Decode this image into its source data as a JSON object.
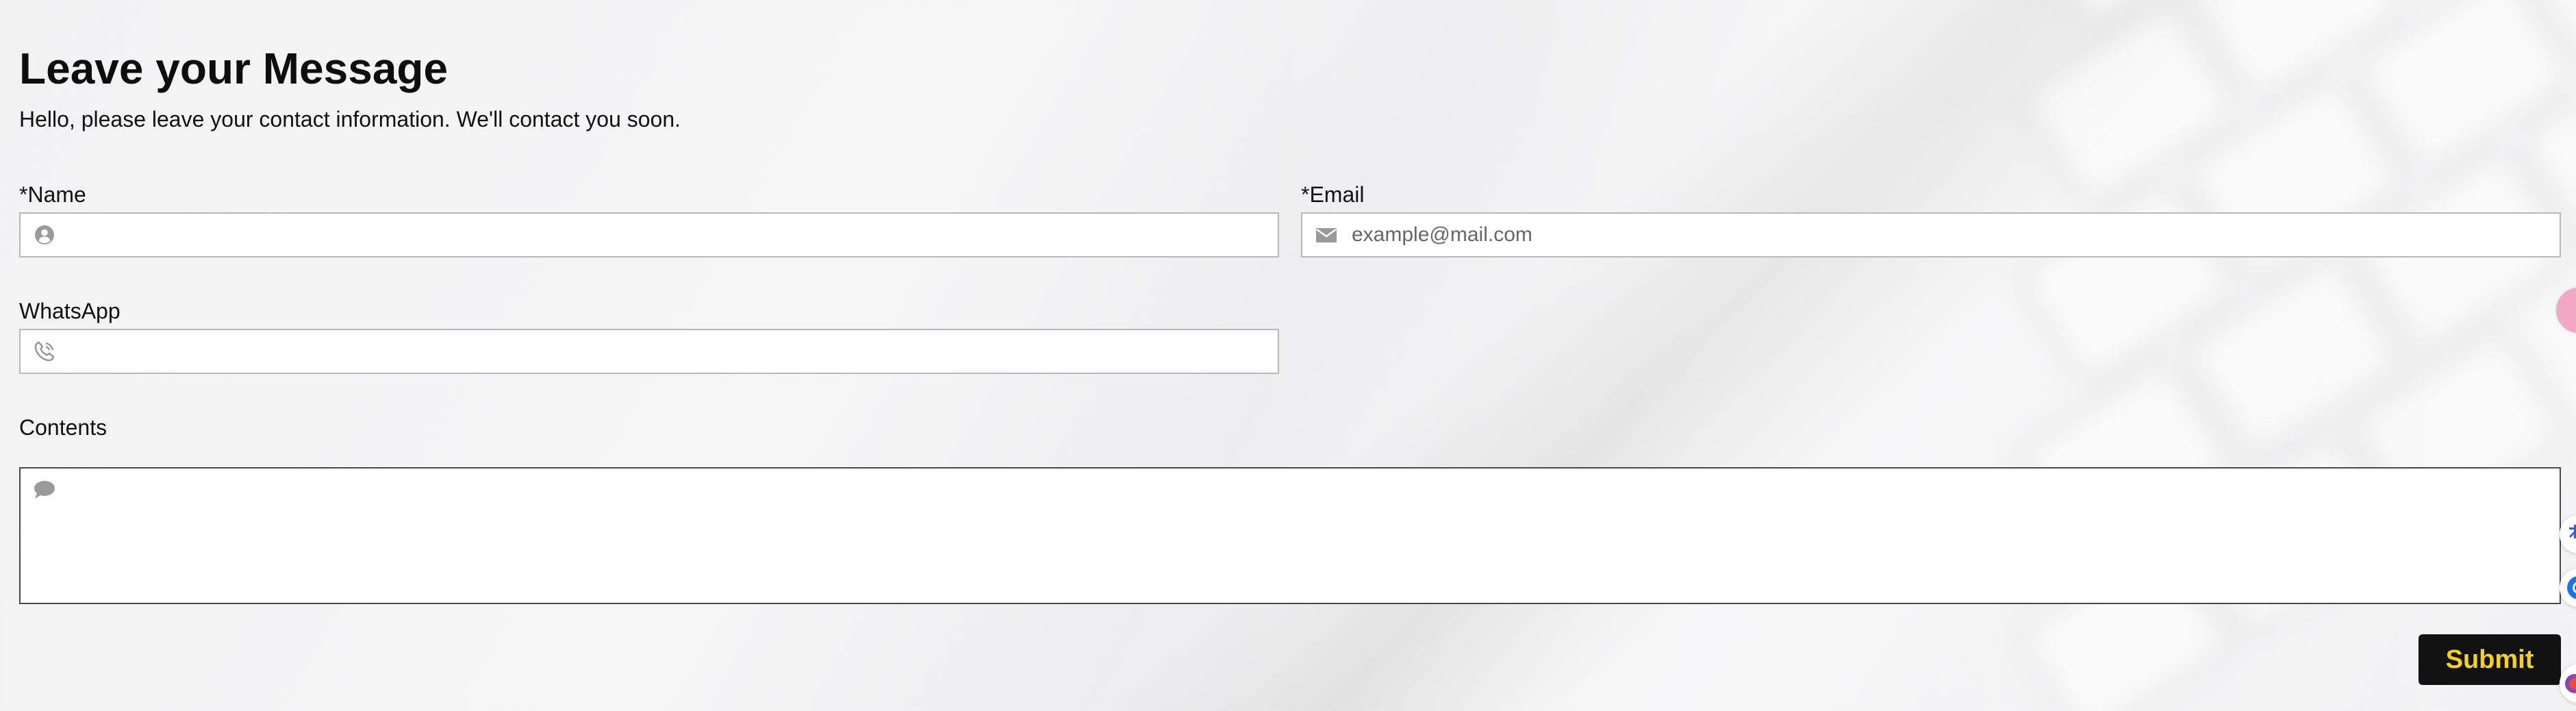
{
  "header": {
    "title": "Leave your Message",
    "subtitle": "Hello, please leave your contact information. We'll contact you soon."
  },
  "form": {
    "name": {
      "label": "*Name",
      "value": "",
      "placeholder": "",
      "icon": "user-icon"
    },
    "email": {
      "label": "*Email",
      "value": "",
      "placeholder": "example@mail.com",
      "icon": "envelope-icon"
    },
    "whatsapp": {
      "label": "WhatsApp",
      "value": "",
      "placeholder": "",
      "icon": "phone-icon"
    },
    "contents": {
      "label": "Contents",
      "value": "",
      "placeholder": "",
      "icon": "comment-icon"
    },
    "submit_label": "Submit"
  },
  "colors": {
    "submit_bg": "#121212",
    "submit_text": "#f4d21c",
    "icon_gray": "#9a9a9a"
  },
  "side_widgets": [
    "help-bubble-icon",
    "translate-icon",
    "chrome-icon",
    "extension-icon"
  ]
}
